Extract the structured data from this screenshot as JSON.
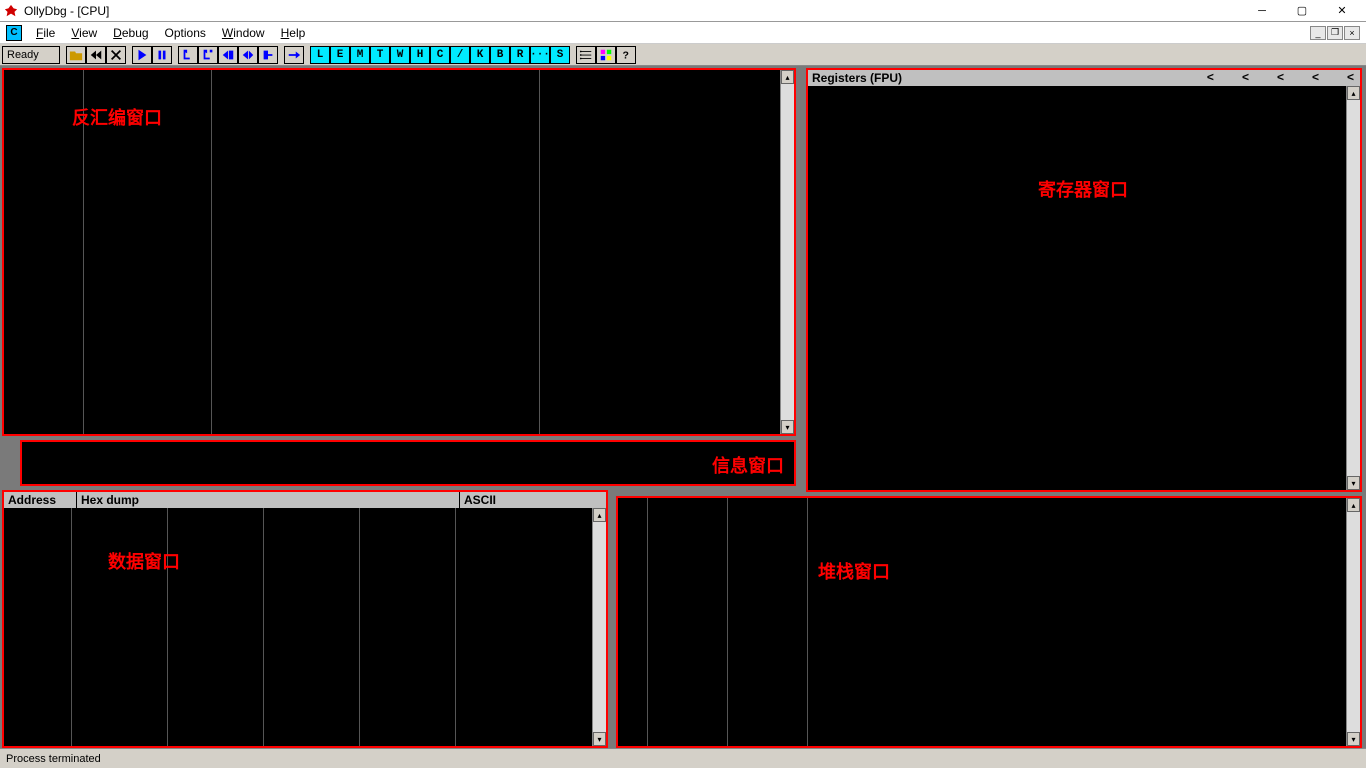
{
  "window": {
    "title": "OllyDbg - [CPU]"
  },
  "menu": {
    "file": "File",
    "view": "View",
    "debug": "Debug",
    "options": "Options",
    "window": "Window",
    "help": "Help"
  },
  "toolbar": {
    "ready": "Ready",
    "letters": [
      "L",
      "E",
      "M",
      "T",
      "W",
      "H",
      "C",
      "/",
      "K",
      "B",
      "R",
      "···",
      "S"
    ]
  },
  "panes": {
    "disasm_label": "反汇编窗口",
    "registers_header": "Registers (FPU)",
    "registers_label": "寄存器窗口",
    "info_label": "信息窗口",
    "dump_headers": {
      "address": "Address",
      "hex": "Hex dump",
      "ascii": "ASCII"
    },
    "dump_label": "数据窗口",
    "stack_label": "堆栈窗口"
  },
  "status": {
    "text": "Process terminated"
  }
}
